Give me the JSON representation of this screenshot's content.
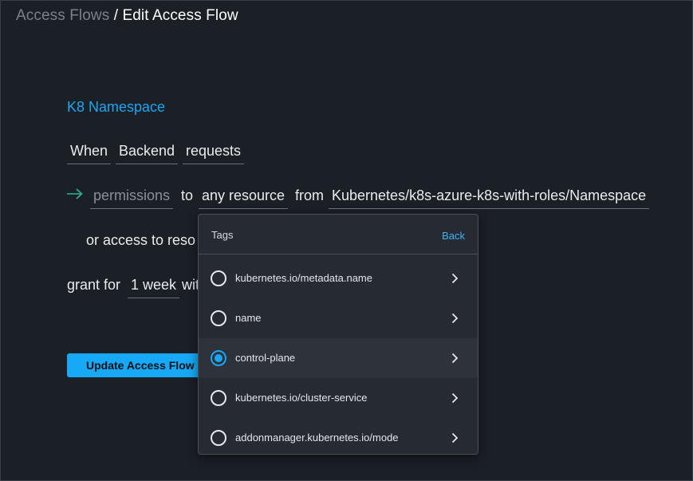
{
  "breadcrumb": {
    "parent": "Access Flows",
    "separator": " / ",
    "current": "Edit Access Flow"
  },
  "flow": {
    "name": "K8 Namespace",
    "when_label": "When",
    "requester": "Backend",
    "requests_label": "requests",
    "permissions": "permissions",
    "to_label": "to",
    "resource": "any resource",
    "from_label": "from",
    "integration": "Kubernetes/k8s-azure-k8s-with-roles/Namespace",
    "or_access_label": "or access to reso",
    "grant_for_label": "grant for",
    "duration": "1 week",
    "with_label": "wit"
  },
  "actions": {
    "update_label": "Update Access Flow"
  },
  "tags_dropdown": {
    "title": "Tags",
    "back_label": "Back",
    "items": [
      {
        "label": "kubernetes.io/metadata.name",
        "selected": false
      },
      {
        "label": "name",
        "selected": false
      },
      {
        "label": "control-plane",
        "selected": true
      },
      {
        "label": "kubernetes.io/cluster-service",
        "selected": false
      },
      {
        "label": "addonmanager.kubernetes.io/mode",
        "selected": false
      }
    ]
  },
  "colors": {
    "background": "#1b1f26",
    "accent": "#1aa6f2",
    "muted": "#7c8189",
    "dropdown_bg": "#262a32"
  },
  "icons": {
    "arrow": "arrow-right-icon",
    "radio": "radio-icon",
    "chevron": "chevron-right-icon"
  }
}
